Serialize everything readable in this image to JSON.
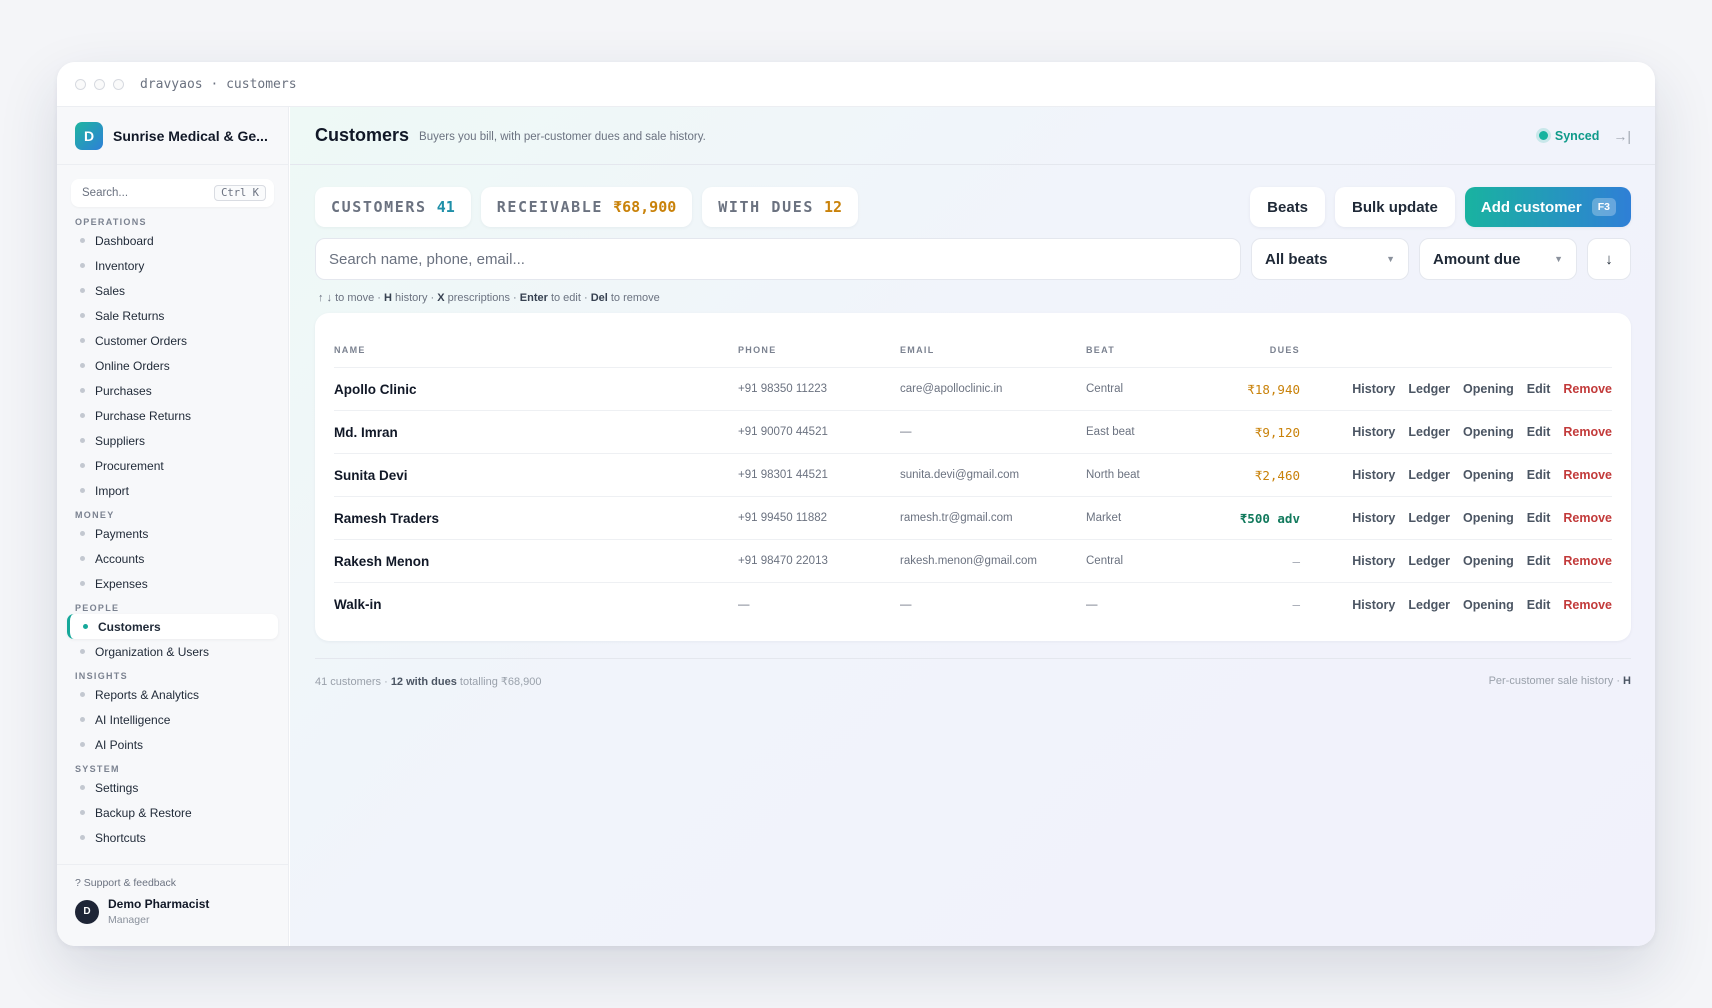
{
  "window": {
    "title": "dravyaos · customers"
  },
  "brand": {
    "initial": "D",
    "name": "Sunrise Medical & Ge..."
  },
  "sidebar": {
    "search_placeholder": "Search...",
    "search_shortcut": "Ctrl K",
    "sections": {
      "operations": "OPERATIONS",
      "money": "MONEY",
      "people": "PEOPLE",
      "insights": "INSIGHTS",
      "system": "SYSTEM"
    },
    "items": {
      "dashboard": "Dashboard",
      "inventory": "Inventory",
      "sales": "Sales",
      "sale_returns": "Sale Returns",
      "customer_orders": "Customer Orders",
      "online_orders": "Online Orders",
      "purchases": "Purchases",
      "purchase_returns": "Purchase Returns",
      "suppliers": "Suppliers",
      "procurement": "Procurement",
      "import": "Import",
      "payments": "Payments",
      "accounts": "Accounts",
      "expenses": "Expenses",
      "customers": "Customers",
      "org_users": "Organization & Users",
      "reports": "Reports & Analytics",
      "ai_intelligence": "AI Intelligence",
      "ai_points": "AI Points",
      "settings": "Settings",
      "backup": "Backup & Restore",
      "shortcuts": "Shortcuts"
    },
    "support": "? Support & feedback",
    "user": {
      "initial": "D",
      "name": "Demo Pharmacist",
      "role": "Manager"
    }
  },
  "header": {
    "title": "Customers",
    "subtitle": "Buyers you bill, with per-customer dues and sale history.",
    "status": "Synced",
    "exit_icon": "→|"
  },
  "stats": [
    {
      "label": "CUSTOMERS",
      "value": "41",
      "color": "#1f8fa8"
    },
    {
      "label": "RECEIVABLE",
      "value": "₹68,900",
      "color": "#c9820a"
    },
    {
      "label": "WITH DUES",
      "value": "12",
      "color": "#c9820a"
    }
  ],
  "toolbar": {
    "beats_label": "Beats",
    "bulk_label": "Bulk update",
    "add_label": "Add customer",
    "add_shortcut": "F3"
  },
  "filters": {
    "search_placeholder": "Search name, phone, email...",
    "beat_select": "All beats",
    "sort_select": "Amount due",
    "sort_dir_icon": "↓"
  },
  "hint": {
    "k1": "↑ ↓",
    "t1": " to move · ",
    "k2": "H",
    "t2": " history · ",
    "k3": "X",
    "t3": " prescriptions · ",
    "k4": "Enter",
    "t4": " to edit · ",
    "k5": "Del",
    "t5": " to remove"
  },
  "table": {
    "columns": {
      "name": "NAME",
      "phone": "PHONE",
      "email": "EMAIL",
      "beat": "BEAT",
      "dues": "DUES"
    },
    "actions": {
      "history": "History",
      "ledger": "Ledger",
      "opening": "Opening",
      "edit": "Edit",
      "remove": "Remove"
    },
    "rows": [
      {
        "name": "Apollo Clinic",
        "phone": "+91 98350 11223",
        "email": "care@apolloclinic.in",
        "beat": "Central",
        "dues": "₹18,940"
      },
      {
        "name": "Md. Imran",
        "phone": "+91 90070 44521",
        "email": "—",
        "beat": "East beat",
        "dues": "₹9,120"
      },
      {
        "name": "Sunita Devi",
        "phone": "+91 98301 44521",
        "email": "sunita.devi@gmail.com",
        "beat": "North beat",
        "dues": "₹2,460"
      },
      {
        "name": "Ramesh Traders",
        "phone": "+91 99450 11882",
        "email": "ramesh.tr@gmail.com",
        "beat": "Market",
        "dues": "₹500 adv"
      },
      {
        "name": "Rakesh Menon",
        "phone": "+91 98470 22013",
        "email": "rakesh.menon@gmail.com",
        "beat": "Central",
        "dues": "—"
      },
      {
        "name": "Walk-in",
        "phone": "—",
        "email": "—",
        "beat": "—",
        "dues": "—"
      }
    ]
  },
  "footer": {
    "count": "41 customers · ",
    "dues": "12 with dues",
    "total": " totalling ₹68,900",
    "right_text": "Per-customer sale history · ",
    "right_key": "H"
  }
}
